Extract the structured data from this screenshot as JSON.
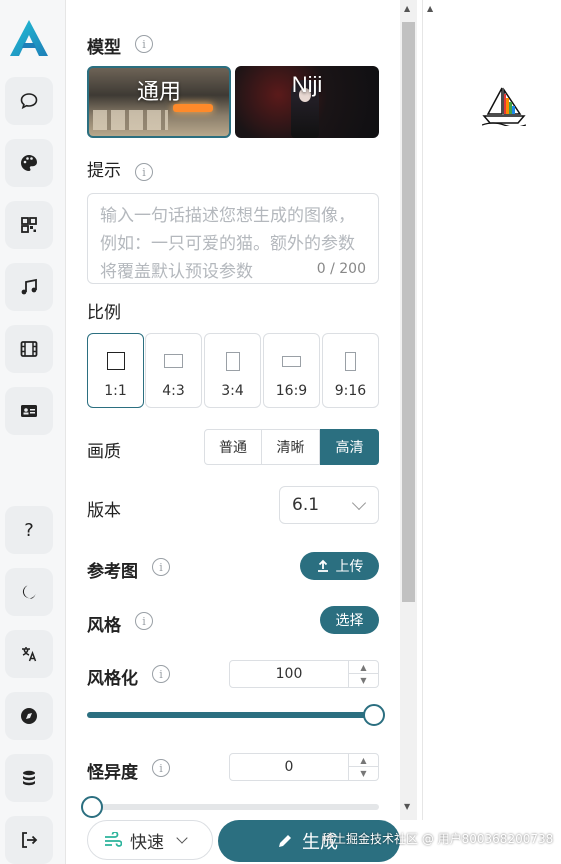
{
  "colors": {
    "accent": "#2b6f80",
    "rail_bg": "#f6f7f8"
  },
  "rail": {
    "items": [
      {
        "name": "chat-icon"
      },
      {
        "name": "palette-icon"
      },
      {
        "name": "qrcode-icon"
      },
      {
        "name": "music-icon"
      },
      {
        "name": "film-icon"
      },
      {
        "name": "id-card-icon"
      },
      {
        "name": "help-icon",
        "glyph": "?"
      },
      {
        "name": "moon-icon"
      },
      {
        "name": "translate-icon"
      },
      {
        "name": "compass-icon"
      },
      {
        "name": "coins-icon"
      },
      {
        "name": "logout-icon"
      }
    ]
  },
  "model": {
    "label": "模型",
    "cards": [
      {
        "name": "通用",
        "selected": true
      },
      {
        "name": "Niji",
        "selected": false
      }
    ]
  },
  "prompt": {
    "label": "提示",
    "placeholder": "输入一句话描述您想生成的图像，例如：一只可爱的猫。额外的参数将覆盖默认预设参数",
    "count": "0 / 200"
  },
  "ratio": {
    "label": "比例",
    "options": [
      "1:1",
      "4:3",
      "3:4",
      "16:9",
      "9:16"
    ],
    "selected": "1:1"
  },
  "quality": {
    "label": "画质",
    "options": [
      "普通",
      "清晰",
      "高清"
    ],
    "selected": "高清"
  },
  "version": {
    "label": "版本",
    "value": "6.1"
  },
  "reference": {
    "label": "参考图",
    "button": "上传"
  },
  "style": {
    "label": "风格",
    "button": "选择"
  },
  "stylize": {
    "label": "风格化",
    "value": "100",
    "fraction": 1.0
  },
  "chaos": {
    "label": "怪异度",
    "value": "0",
    "fraction": 0.0
  },
  "footer": {
    "speed": "快速",
    "generate": "生成"
  },
  "watermark": "稀土掘金技术社区 @ 用户800368200738"
}
